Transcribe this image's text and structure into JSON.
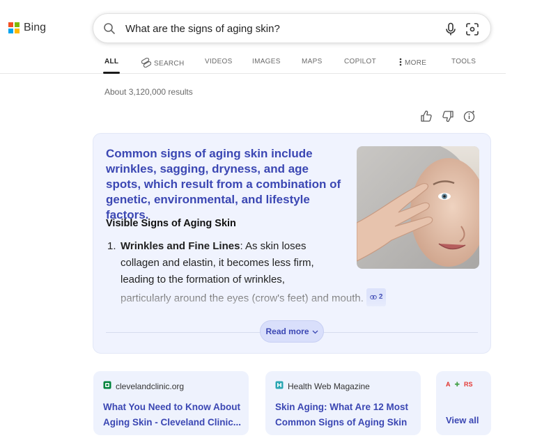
{
  "brand": {
    "name": "Bing",
    "logo_colors": [
      "#f25022",
      "#7fba00",
      "#00a4ef",
      "#ffb900"
    ]
  },
  "search": {
    "query": "What are the signs of aging skin?",
    "icons": [
      "search-icon",
      "microphone-icon",
      "visual-search-icon"
    ]
  },
  "tabs": [
    {
      "label": "ALL",
      "active": true
    },
    {
      "label": "SEARCH",
      "icon": "copilot-search-icon"
    },
    {
      "label": "VIDEOS"
    },
    {
      "label": "IMAGES"
    },
    {
      "label": "MAPS"
    },
    {
      "label": "COPILOT"
    },
    {
      "label": "MORE",
      "icon": "more-vertical-icon"
    },
    {
      "label": "TOOLS"
    }
  ],
  "results": {
    "count_text": "About 3,120,000 results"
  },
  "feedback": {
    "icons": [
      "thumbs-up-icon",
      "thumbs-down-icon",
      "info-icon"
    ]
  },
  "answer": {
    "headline": "Common signs of aging skin include wrinkles, sagging, dryness, and age spots, which result from a combination of genetic, environmental, and lifestyle factors.",
    "subheading": "Visible Signs of Aging Skin",
    "items": [
      {
        "number": "1.",
        "term": "Wrinkles and Fine Lines",
        "text_lines": [
          ": As skin loses",
          "collagen and elastin, it becomes less firm,",
          "leading to the formation of wrinkles,",
          "particularly around the eyes (crow's feet) and mouth."
        ],
        "citation_count": "2"
      }
    ],
    "read_more_label": "Read more",
    "accent_color": "#3b47b3"
  },
  "sources": [
    {
      "site": "clevelandclinic.org",
      "title": "What You Need to Know About Aging Skin - Cleveland Clinic..."
    },
    {
      "site": "Health Web Magazine",
      "title": "Skin Aging: What Are 12 Most Common Signs of Aging Skin"
    }
  ],
  "more_sources": {
    "mini_logos": [
      "A",
      "✚",
      "RS"
    ],
    "label": "View all"
  }
}
